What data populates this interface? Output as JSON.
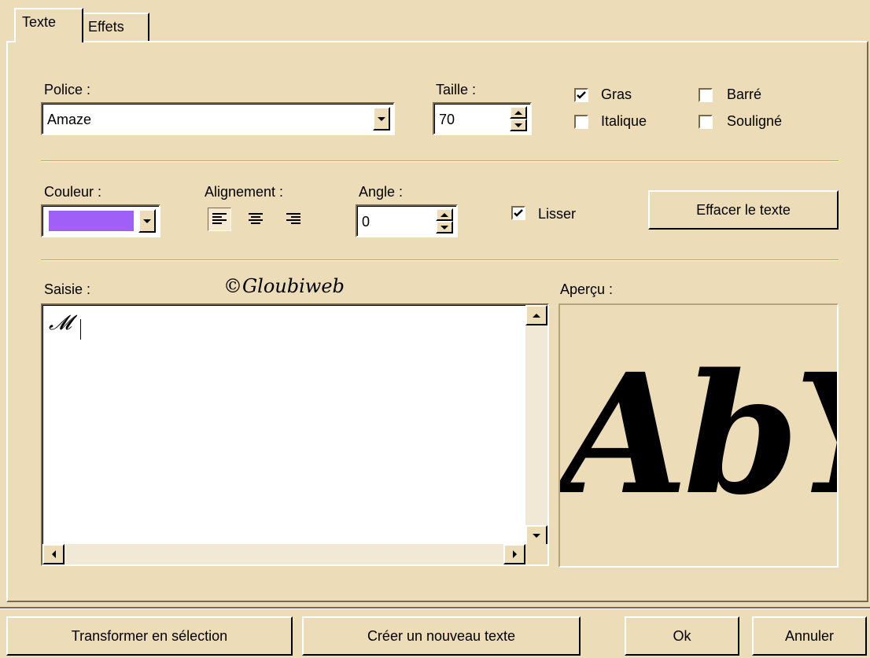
{
  "tabs": [
    {
      "label": "Texte",
      "active": true
    },
    {
      "label": "Effets",
      "active": false
    }
  ],
  "police": {
    "label": "Police :",
    "value": "Amaze"
  },
  "taille": {
    "label": "Taille :",
    "value": "70"
  },
  "options": {
    "gras": {
      "label": "Gras",
      "checked": true
    },
    "italique": {
      "label": "Italique",
      "checked": false
    },
    "barre": {
      "label": "Barré",
      "checked": false
    },
    "souligne": {
      "label": "Souligné",
      "checked": false
    }
  },
  "couleur": {
    "label": "Couleur :",
    "value": "#a060f8"
  },
  "alignement": {
    "label": "Alignement :",
    "options": [
      "align-left",
      "align-center",
      "align-right"
    ],
    "selected": "align-left"
  },
  "angle": {
    "label": "Angle :",
    "value": "0"
  },
  "lisser": {
    "label": "Lisser",
    "checked": true
  },
  "effacer_button": "Effacer le texte",
  "saisie": {
    "label": "Saisie :",
    "text": "𝓜"
  },
  "watermark": "©Gloubiweb",
  "apercu": {
    "label": "Aperçu :",
    "preview_text": "AbY"
  },
  "footer": {
    "transformer": "Transformer en sélection",
    "creer": "Créer un nouveau texte",
    "ok": "Ok",
    "annuler": "Annuler"
  }
}
